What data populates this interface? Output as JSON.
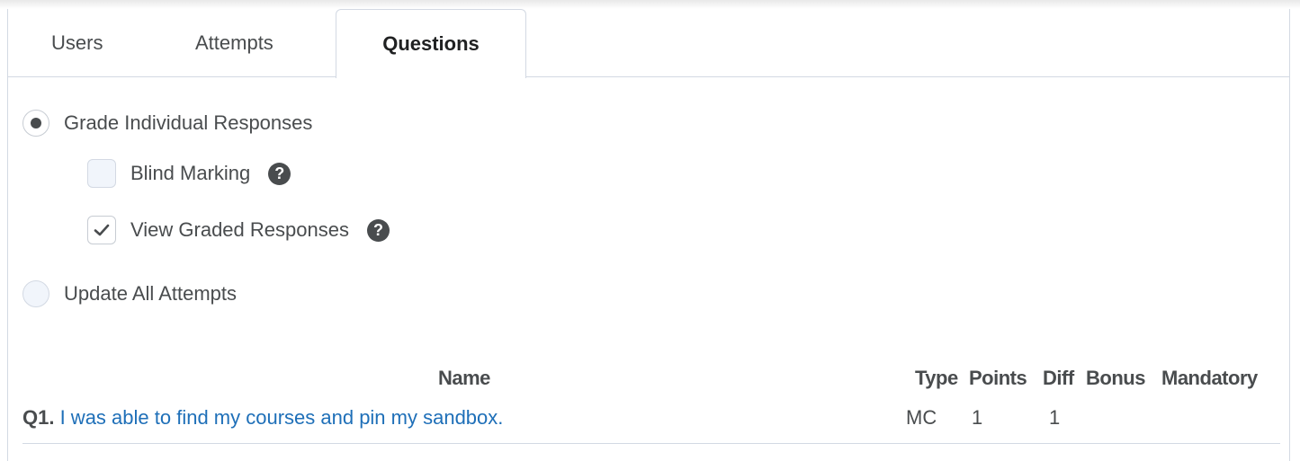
{
  "tabs": [
    {
      "label": "Users",
      "active": false
    },
    {
      "label": "Attempts",
      "active": false
    },
    {
      "label": "Questions",
      "active": true
    }
  ],
  "grading_mode": {
    "individual": {
      "label": "Grade Individual Responses",
      "selected": true
    },
    "blind_marking": {
      "label": "Blind Marking",
      "checked": false,
      "help_icon": "question-circle-icon"
    },
    "view_graded": {
      "label": "View Graded Responses",
      "checked": true,
      "help_icon": "question-circle-icon"
    },
    "update_all": {
      "label": "Update All Attempts",
      "selected": false
    }
  },
  "table": {
    "headers": {
      "name": "Name",
      "type": "Type",
      "points": "Points",
      "diff": "Diff",
      "bonus": "Bonus",
      "mandatory": "Mandatory"
    },
    "rows": [
      {
        "number": "Q1.",
        "question": "I was able to find my courses and pin my sandbox.",
        "type": "MC",
        "points": "1",
        "diff": "1",
        "bonus": "",
        "mandatory": ""
      }
    ]
  },
  "colors": {
    "text": "#494c4e",
    "link": "#1e6fb8",
    "border": "#d3d9e3"
  }
}
